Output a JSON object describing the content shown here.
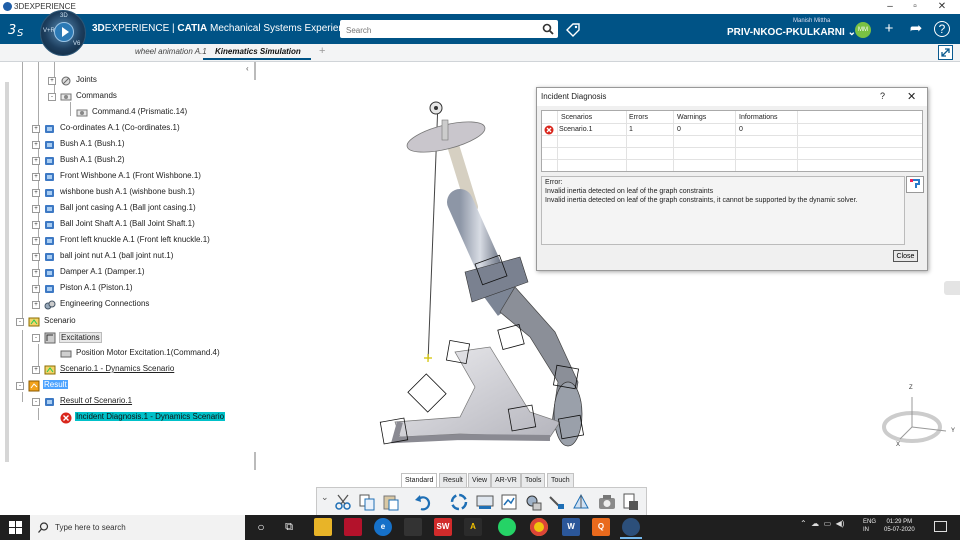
{
  "window": {
    "title": "3DEXPERIENCE"
  },
  "header": {
    "brand_bold": "3D",
    "brand_rest": "EXPERIENCE | ",
    "brand_app": "CATIA",
    "brand_sub": " Mechanical Systems Experience",
    "search_placeholder": "Search",
    "user_name": "Manish Mittha",
    "tenant": "PRIV-NKOC-PKULKARNI",
    "avatar_initials": "MM",
    "compass_labels": [
      "3D",
      "V+R",
      "V6"
    ]
  },
  "tabs": [
    {
      "label": "wheel animation A.1"
    },
    {
      "label": "Kinematics Simulation"
    }
  ],
  "tree": [
    {
      "label": "Joints"
    },
    {
      "label": "Commands"
    },
    {
      "label": "Command.4 (Prismatic.14)"
    },
    {
      "label": "Co-ordinates A.1 (Co-ordinates.1)"
    },
    {
      "label": "Bush A.1 (Bush.1)"
    },
    {
      "label": "Bush A.1 (Bush.2)"
    },
    {
      "label": "Front Wishbone A.1 (Front Wishbone.1)"
    },
    {
      "label": "wishbone bush A.1 (wishbone bush.1)"
    },
    {
      "label": "Ball jont casing A.1 (Ball jont casing.1)"
    },
    {
      "label": "Ball Joint Shaft A.1 (Ball Joint Shaft.1)"
    },
    {
      "label": "Front left knuckle A.1 (Front left knuckle.1)"
    },
    {
      "label": "ball joint nut A.1 (ball joint nut.1)"
    },
    {
      "label": "Damper A.1 (Damper.1)"
    },
    {
      "label": "Piston A.1 (Piston.1)"
    },
    {
      "label": "Engineering Connections"
    },
    {
      "label": "Scenario"
    },
    {
      "label": "Excitations"
    },
    {
      "label": "Position Motor Excitation.1(Command.4)"
    },
    {
      "label": "Scenario.1 - Dynamics Scenario"
    },
    {
      "label": "Result"
    },
    {
      "label": "Result of Scenario.1"
    },
    {
      "label": "Incident Diagnosis.1 - Dynamics Scenario"
    }
  ],
  "dialog": {
    "title": "Incident Diagnosis",
    "help": "?",
    "close_x": "✕",
    "columns": [
      "Scenarios",
      "Errors",
      "Warnings",
      "Informations"
    ],
    "rows": [
      {
        "scenario": "Scenario.1",
        "errors": "1",
        "warnings": "0",
        "informations": "0"
      }
    ],
    "error_heading": "Error:",
    "error_line1": "Invalid inertia detected on leaf of the graph constraints",
    "error_line2": "Invalid inertia detected on leaf of the graph constraints, it cannot be supported by the dynamic solver.",
    "close_button": "Close"
  },
  "viewport": {
    "axis_x": "X",
    "axis_y": "Y",
    "axis_z": "Z"
  },
  "action_tabs": [
    "Standard",
    "Result",
    "View",
    "AR-VR",
    "Tools",
    "Touch"
  ],
  "taskbar": {
    "search_placeholder": "Type here to search",
    "language_1": "ENG",
    "language_2": "IN",
    "time": "01:29 PM",
    "date": "05-07-2020"
  },
  "colors": {
    "header_bg": "#005386",
    "selection": "#4da3ff",
    "highlight": "#00c1c9",
    "error_red": "#d9261c"
  }
}
